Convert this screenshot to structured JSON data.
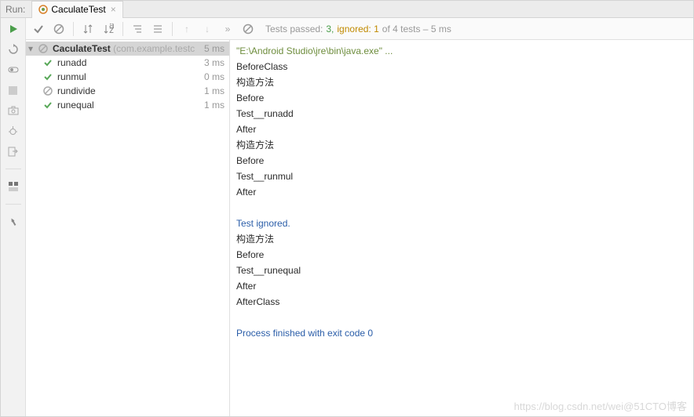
{
  "tabbar": {
    "run_label": "Run:",
    "tab_name": "CaculateTest"
  },
  "toolbar": {
    "status_prefix": "Tests passed: ",
    "passed_count": "3,",
    "ignored_label": " ignored: ",
    "ignored_count": "1",
    "of_suffix": " of 4 tests – 5 ms"
  },
  "tree": {
    "root": {
      "name": "CaculateTest",
      "pkg": " (com.example.testc",
      "time": "5 ms"
    },
    "items": [
      {
        "status": "pass",
        "name": "runadd",
        "time": "3 ms"
      },
      {
        "status": "pass",
        "name": "runmul",
        "time": "0 ms"
      },
      {
        "status": "skip",
        "name": "rundivide",
        "time": "1 ms"
      },
      {
        "status": "pass",
        "name": "runequal",
        "time": "1 ms"
      }
    ]
  },
  "console": {
    "cmd": "\"E:\\Android Studio\\jre\\bin\\java.exe\" ...",
    "lines": [
      "BeforeClass",
      "构造方法",
      "Before",
      "Test__runadd",
      "After",
      "构造方法",
      "Before",
      "Test__runmul",
      "After",
      ""
    ],
    "ignored": "Test ignored.",
    "lines2": [
      "构造方法",
      "Before",
      "Test__runequal",
      "After",
      "AfterClass",
      ""
    ],
    "exit": "Process finished with exit code 0"
  },
  "watermark": "https://blog.csdn.net/wei@51CTO博客"
}
